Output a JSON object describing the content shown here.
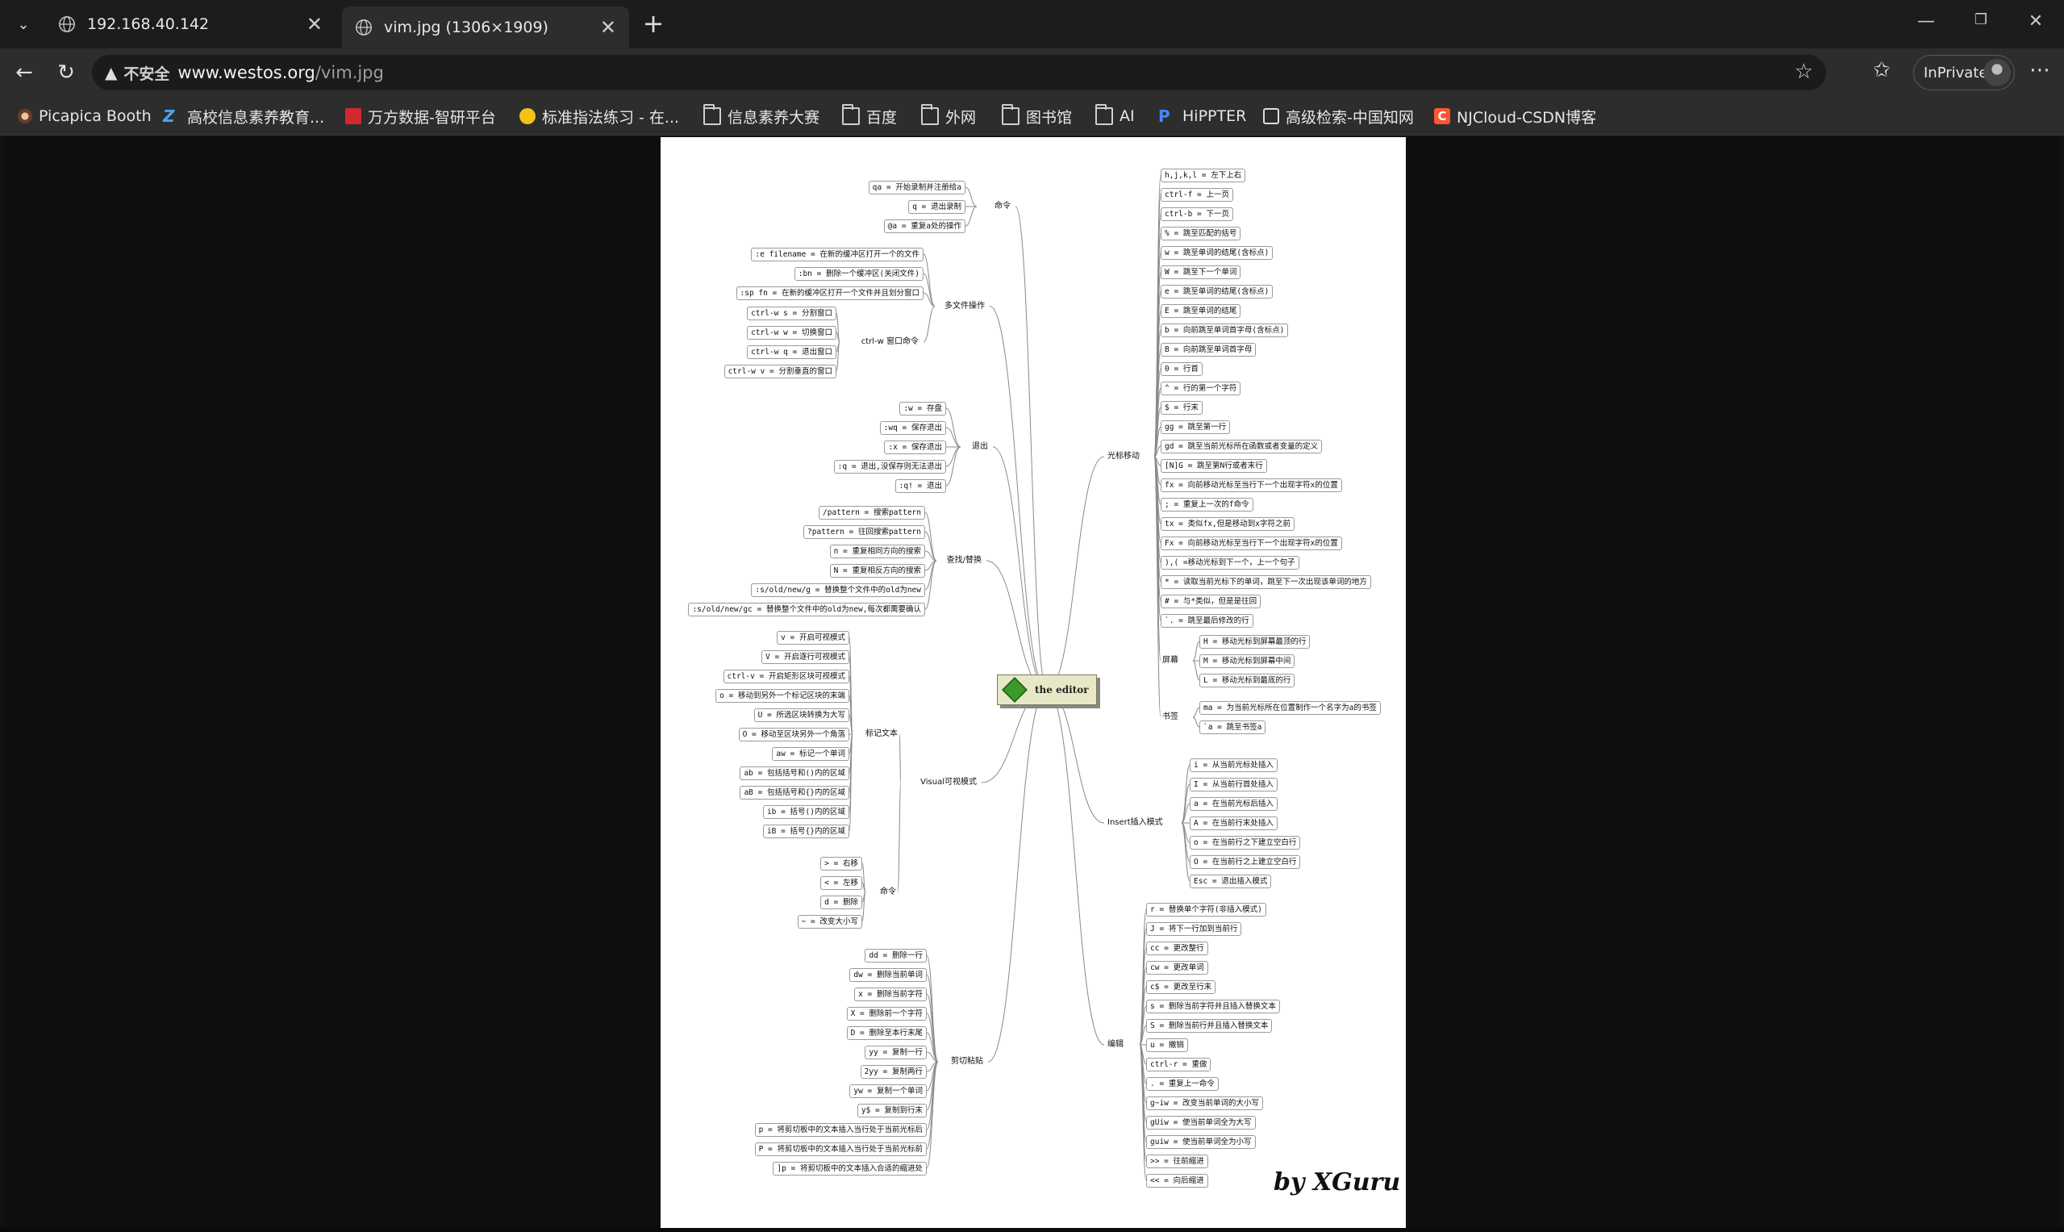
{
  "tabs": [
    {
      "title": "192.168.40.142",
      "active": false
    },
    {
      "title": "vim.jpg (1306×1909)",
      "active": true
    }
  ],
  "address": {
    "insecure_label": "不安全",
    "host": "www.westos.org",
    "path": "/vim.jpg"
  },
  "inprivate_label": "InPrivate",
  "bookmarks": [
    {
      "label": "Picapica Booth",
      "icon": "photo-booth-icon"
    },
    {
      "label": "高校信息素养教育...",
      "icon": "z-logo-icon"
    },
    {
      "label": "万方数据-智研平台",
      "icon": "wanfang-logo-icon"
    },
    {
      "label": "标准指法练习 - 在...",
      "icon": "emoji-icon"
    },
    {
      "label": "信息素养大赛",
      "icon": "folder-icon"
    },
    {
      "label": "百度",
      "icon": "folder-icon"
    },
    {
      "label": "外网",
      "icon": "folder-icon"
    },
    {
      "label": "图书馆",
      "icon": "folder-icon"
    },
    {
      "label": "AI",
      "icon": "folder-icon"
    },
    {
      "label": "HiPPTER",
      "icon": "p-logo-icon"
    },
    {
      "label": "高级检索-中国知网",
      "icon": "cnki-logo-icon"
    },
    {
      "label": "NJCloud-CSDN博客",
      "icon": "csdn-logo-icon"
    }
  ],
  "colors": {
    "tabbar": "#1c1c1c",
    "toolbar": "#2d2d2d",
    "viewer_bg": "#0e0e0e",
    "csdn": "#fc5531",
    "wanfang": "#d3282f"
  },
  "mindmap": {
    "center": "the editor",
    "signature": "by XGuru",
    "branches_left": [
      {
        "name": "命令",
        "items": [
          "qa = 开始录制并注册给a",
          "q = 退出录制",
          "@a = 重复a处的操作"
        ]
      },
      {
        "name": "多文件操作",
        "items": [
          ":e filename = 在新的缓冲区打开一个的文件",
          ":bn = 删除一个缓冲区(关闭文件)",
          ":sp fn = 在新的缓冲区打开一个文件并且划分窗口"
        ],
        "sub": {
          "name": "ctrl-w 窗口命令",
          "items": [
            "ctrl-w s = 分割窗口",
            "ctrl-w w = 切换窗口",
            "ctrl-w q = 退出窗口",
            "ctrl-w v = 分割垂直的窗口"
          ]
        }
      },
      {
        "name": "退出",
        "items": [
          ":w = 存盘",
          ":wq = 保存退出",
          ":x = 保存退出",
          ":q = 退出,没保存则无法退出",
          ":q! = 退出"
        ]
      },
      {
        "name": "查找/替换",
        "items": [
          "/pattern = 搜索pattern",
          "?pattern = 往回搜索pattern",
          "n = 重复相同方向的搜索",
          "N = 重复相反方向的搜索",
          ":s/old/new/g = 替换整个文件中的old为new",
          ":s/old/new/gc = 替换整个文件中的old为new,每次都需要确认"
        ]
      },
      {
        "name": "Visual可视模式",
        "sub1": {
          "name": "标记文本",
          "items": [
            "v = 开启可视模式",
            "V = 开启逐行可视模式",
            "ctrl-v = 开启矩形区块可视模式",
            "o = 移动到另外一个标记区块的末端",
            "U = 所选区块转换为大写",
            "O = 移动至区块另外一个角落",
            "aw = 标记一个单词",
            "ab = 包括括号和()内的区域",
            "aB = 包括括号和{}内的区域",
            "ib = 括号()内的区域",
            "iB = 括号{}内的区域"
          ]
        },
        "sub2": {
          "name": "命令",
          "items": [
            "> = 右移",
            "< = 左移",
            "d = 删除",
            "~ = 改变大小写"
          ]
        }
      },
      {
        "name": "剪切粘贴",
        "items": [
          "dd = 删除一行",
          "dw = 删除当前单词",
          "x = 删除当前字符",
          "X = 删除前一个字符",
          "D = 删除至本行末尾",
          "yy = 复制一行",
          "2yy = 复制两行",
          "yw = 复制一个单词",
          "y$ = 复制到行末",
          "p = 将剪切板中的文本插入当行处于当前光标后",
          "P = 将剪切板中的文本插入当行处于当前光标前",
          "]p = 将剪切板中的文本插入合适的缩进处"
        ]
      }
    ],
    "branches_right": [
      {
        "name": "光标移动",
        "items": [
          "h,j,k,l = 左下上右",
          "ctrl-f = 上一页",
          "ctrl-b = 下一页",
          "% = 跳至匹配的括号",
          "w = 跳至单词的结尾(含标点)",
          "W = 跳至下一个单词",
          "e = 跳至单词的结尾(含标点)",
          "E = 跳至单词的结尾",
          "b = 向前跳至单词首字母(含标点)",
          "B = 向前跳至单词首字母",
          "0 = 行首",
          "^ = 行的第一个字符",
          "$ = 行末",
          "gg = 跳至第一行",
          "gd = 跳至当前光标所在函数或者变量的定义",
          "[N]G = 跳至第N行或者末行",
          "fx = 向前移动光标至当行下一个出现字符x的位置",
          "; = 重复上一次的f命令",
          "tx = 类似fx,但是移动到x字符之前",
          "Fx = 向前移动光标至当行下一个出现字符x的位置",
          "),( =移动光标到下一个，上一个句子",
          "* = 读取当前光标下的单词，跳至下一次出现该单词的地方",
          "# = 与*类似，但是是往回",
          "`. = 跳至最后修改的行"
        ],
        "sub1": {
          "name": "屏幕",
          "items": [
            "H = 移动光标到屏幕最顶的行",
            "M = 移动光标到屏幕中间",
            "L = 移动光标到最底的行"
          ]
        },
        "sub2": {
          "name": "书签",
          "items": [
            "ma = 为当前光标所在位置制作一个名字为a的书签",
            "`a = 跳至书签a"
          ]
        }
      },
      {
        "name": "Insert插入模式",
        "items": [
          "i = 从当前光标处插入",
          "I = 从当前行首处插入",
          "a = 在当前光标后插入",
          "A = 在当前行末处插入",
          "o = 在当前行之下建立空白行",
          "O = 在当前行之上建立空白行",
          "Esc = 退出插入模式"
        ]
      },
      {
        "name": "编辑",
        "items": [
          "r = 替换单个字符(非插入模式)",
          "J = 将下一行加到当前行",
          "cc = 更改整行",
          "cw = 更改单词",
          "c$ = 更改至行末",
          "s = 删除当前字符并且插入替换文本",
          "S = 删除当前行并且插入替换文本",
          "u = 撤销",
          "ctrl-r = 重做",
          ". = 重复上一命令",
          "g~iw = 改变当前单词的大小写",
          "gUiw = 使当前单词全为大写",
          "guiw = 使当前单词全为小写",
          ">> = 往前缩进",
          "<< = 向后缩进"
        ]
      }
    ]
  }
}
